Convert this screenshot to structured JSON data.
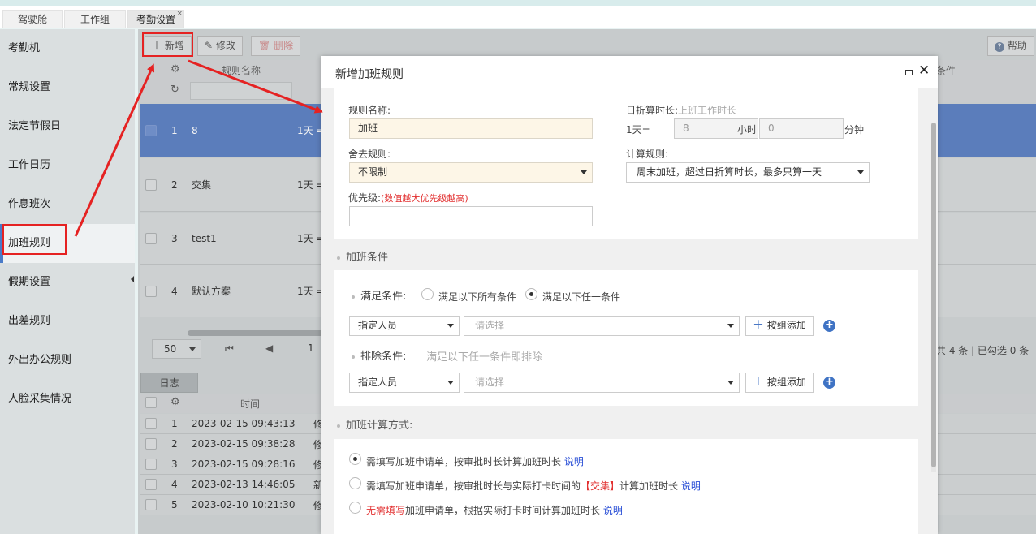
{
  "tabs": [
    {
      "label": "驾驶舱"
    },
    {
      "label": "工作组"
    },
    {
      "label": "考勤设置",
      "close": "×"
    }
  ],
  "sidebar": {
    "items": [
      {
        "label": "考勤机"
      },
      {
        "label": "常规设置"
      },
      {
        "label": "法定节假日"
      },
      {
        "label": "工作日历"
      },
      {
        "label": "作息班次"
      },
      {
        "label": "加班规则"
      },
      {
        "label": "假期设置"
      },
      {
        "label": "出差规则"
      },
      {
        "label": "外出办公规则"
      },
      {
        "label": "人脸采集情况"
      }
    ],
    "active_index": 5
  },
  "toolbar": {
    "add": "新增",
    "edit": "修改",
    "delete": "删除",
    "help": "帮助"
  },
  "grid": {
    "columns": {
      "name": "规则名称",
      "cond": "条件"
    },
    "rows": [
      {
        "no": "1",
        "name": "8",
        "detail": "1天 ="
      },
      {
        "no": "2",
        "name": "交集",
        "detail": "1天 ="
      },
      {
        "no": "3",
        "name": "test1",
        "detail": "1天 ="
      },
      {
        "no": "4",
        "name": "默认方案",
        "detail": "1天 ="
      }
    ],
    "pager": {
      "size": "50",
      "page": "1",
      "summary": "共 4 条 | 已勾选 0 条"
    }
  },
  "log": {
    "tab": "日志",
    "col_time": "时间",
    "rows": [
      {
        "no": "1",
        "time": "2023-02-15 09:43:13",
        "op": "修"
      },
      {
        "no": "2",
        "time": "2023-02-15 09:38:28",
        "op": "修"
      },
      {
        "no": "3",
        "time": "2023-02-15 09:28:16",
        "op": "修"
      },
      {
        "no": "4",
        "time": "2023-02-13 14:46:05",
        "op": "新"
      },
      {
        "no": "5",
        "time": "2023-02-10 10:21:30",
        "op": "修"
      }
    ]
  },
  "dialog": {
    "title": "新增加班规则",
    "rule_name_label": "规则名称:",
    "rule_name_value": "加班",
    "day_convert_label": "日折算时长:",
    "day_convert_hint": "上班工作时长",
    "day_eq": "1天=",
    "hours_value": "8",
    "hours_unit": "小时",
    "minutes_value": "0",
    "minutes_unit": "分钟",
    "round_label": "舍去规则:",
    "round_value": "不限制",
    "calc_label": "计算规则:",
    "calc_value": "周末加班，超过日折算时长，最多只算一天",
    "priority_label": "优先级:",
    "priority_hint": "(数值越大优先级越高)",
    "cond_section": "加班条件",
    "meet_label": "满足条件:",
    "meet_all": "满足以下所有条件",
    "meet_any": "满足以下任一条件",
    "person_select": "指定人员",
    "please_select": "请选择",
    "add_by_group": "按组添加",
    "exclude_label": "排除条件:",
    "exclude_hint": "满足以下任一条件即排除",
    "calc_section": "加班计算方式:",
    "opt1": "需填写加班申请单，按审批时长计算加班时长",
    "opt2a": "需填写加班申请单，按审批时长与实际打卡时间的",
    "opt2b": "【交集】",
    "opt2c": "计算加班时长",
    "opt3a": "无需填写",
    "opt3b": "加班申请单，根据实际打卡时间计算加班时长",
    "explain": "说明"
  }
}
